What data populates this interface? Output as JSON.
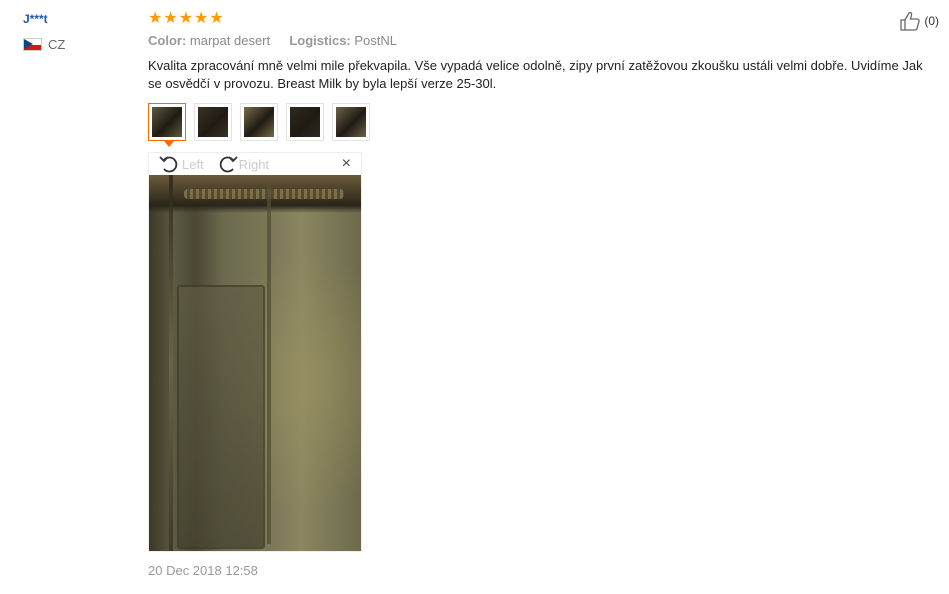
{
  "reviewer": {
    "name": "J***t",
    "country": "CZ",
    "flag_icon": "czech-flag-icon"
  },
  "rating": {
    "stars": 5,
    "max": 5,
    "star_color": "#ff9a00"
  },
  "meta": {
    "color_label": "Color:",
    "color_value": "marpat desert",
    "logistics_label": "Logistics:",
    "logistics_value": "PostNL"
  },
  "review": {
    "text": "Kvalita zpracování mně velmi mile překvapila. Vše vypadá velice odolně, zipy první zatěžovou zkoušku ustáli velmi dobře. Uvidíme Jak se osvědčí v provozu. Breast Milk by byla lepší verze 25-30l."
  },
  "like": {
    "count": "(0)",
    "icon": "thumbs-up-icon"
  },
  "thumbnails": [
    {
      "label": "photo-1",
      "active": true,
      "tone": "#5e5a40"
    },
    {
      "label": "photo-2",
      "active": false,
      "tone": "#3a3325"
    },
    {
      "label": "photo-3",
      "active": false,
      "tone": "#7a6a4c"
    },
    {
      "label": "photo-4",
      "active": false,
      "tone": "#2e2a1f"
    },
    {
      "label": "photo-5",
      "active": false,
      "tone": "#6e6248"
    }
  ],
  "viewer": {
    "rotate_left": "Left",
    "rotate_right": "Right",
    "close": "×"
  },
  "date": "20 Dec 2018 12:58",
  "colors": {
    "accent": "#ff6a00",
    "username": "#1a5aa8"
  }
}
